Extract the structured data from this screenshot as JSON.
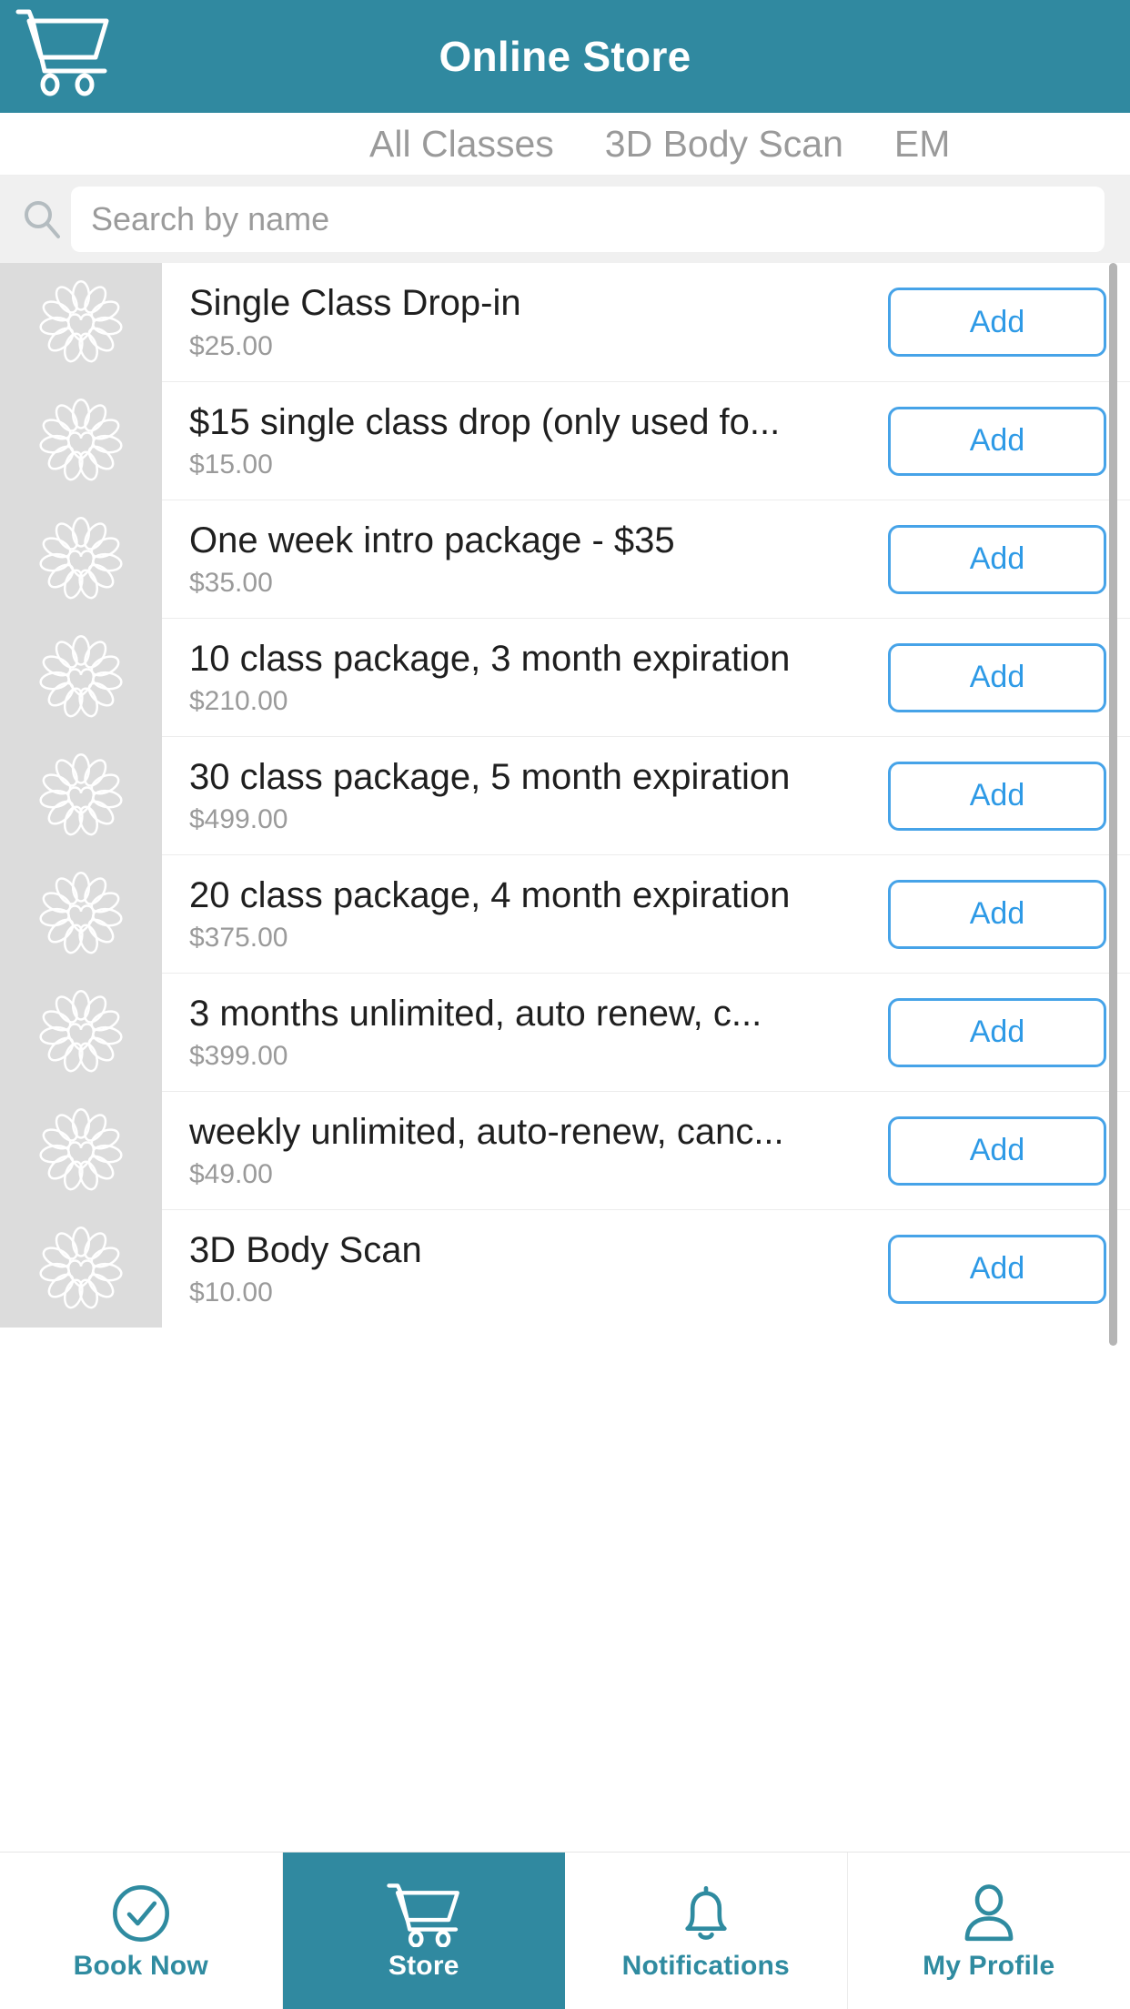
{
  "header": {
    "title": "Online Store",
    "cart_icon": "shopping-cart-icon",
    "background_color": "#3089a0"
  },
  "tabs": [
    {
      "label": "All Classes",
      "active": false
    },
    {
      "label": "3D Body Scan",
      "active": false
    },
    {
      "label": "EM",
      "active": false
    }
  ],
  "search": {
    "placeholder": "Search by name",
    "value": "",
    "icon": "search-icon"
  },
  "products": [
    {
      "name": "Single Class Drop-in",
      "price": "$25.00",
      "add_label": "Add",
      "thumb_icon": "flower-heart-icon"
    },
    {
      "name": "$15 single class drop (only used fo...",
      "price": "$15.00",
      "add_label": "Add",
      "thumb_icon": "flower-heart-icon"
    },
    {
      "name": "One week intro package - $35",
      "price": "$35.00",
      "add_label": "Add",
      "thumb_icon": "flower-heart-icon"
    },
    {
      "name": "10 class package, 3 month expiration",
      "price": "$210.00",
      "add_label": "Add",
      "thumb_icon": "flower-heart-icon"
    },
    {
      "name": "30 class package, 5 month expiration",
      "price": "$499.00",
      "add_label": "Add",
      "thumb_icon": "flower-heart-icon"
    },
    {
      "name": "20 class package, 4 month expiration",
      "price": "$375.00",
      "add_label": "Add",
      "thumb_icon": "flower-heart-icon"
    },
    {
      "name": "3 months unlimited, auto renew, c...",
      "price": "$399.00",
      "add_label": "Add",
      "thumb_icon": "flower-heart-icon"
    },
    {
      "name": "weekly unlimited, auto-renew, canc...",
      "price": "$49.00",
      "add_label": "Add",
      "thumb_icon": "flower-heart-icon"
    },
    {
      "name": "3D Body Scan",
      "price": "$10.00",
      "add_label": "Add",
      "thumb_icon": "flower-heart-icon"
    }
  ],
  "bottom_nav": [
    {
      "label": "Book Now",
      "icon": "check-circle-icon",
      "active": false
    },
    {
      "label": "Store",
      "icon": "shopping-cart-icon",
      "active": true
    },
    {
      "label": "Notifications",
      "icon": "bell-icon",
      "active": false
    },
    {
      "label": "My Profile",
      "icon": "person-icon",
      "active": false
    }
  ],
  "colors": {
    "brand_teal": "#3089a0",
    "accent_blue": "#2e9ae6",
    "thumb_gray": "#dcdcdc",
    "muted_text": "#9a9a9a"
  }
}
